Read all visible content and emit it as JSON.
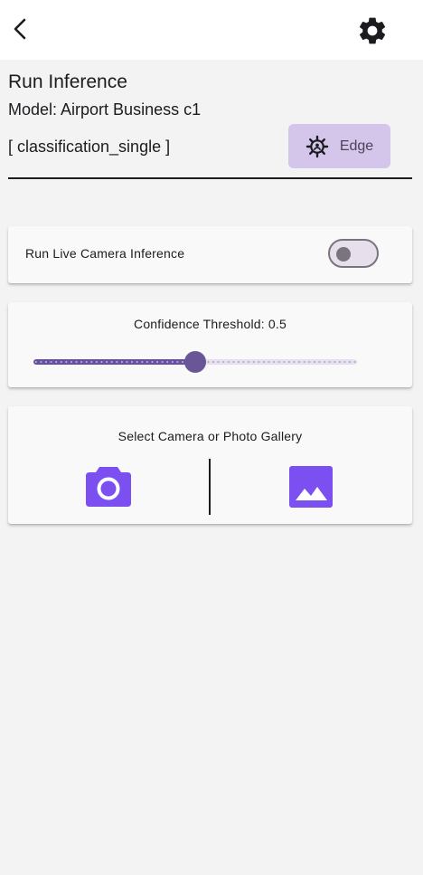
{
  "appbar": {
    "back_icon": "arrow-back-ios-icon",
    "settings_icon": "gear-icon"
  },
  "header": {
    "title": "Run Inference",
    "model": "Model: Airport Business c1",
    "task_type": "[ classification_single ]",
    "edge_chip": {
      "label": "Edge",
      "icon": "edge-device-icon"
    }
  },
  "live_inference": {
    "label": "Run Live Camera Inference",
    "enabled": false
  },
  "threshold": {
    "label": "Confidence Threshold: 0.5",
    "value": 0.5,
    "min": 0,
    "max": 1
  },
  "source": {
    "label": "Select Camera or Photo Gallery",
    "camera_icon": "camera-icon",
    "gallery_icon": "photo-gallery-icon"
  },
  "colors": {
    "accent": "#6750a4",
    "icon_purple": "#7b4ff0",
    "chip_background": "#d3c6ea",
    "background": "#f3f3f3",
    "card": "#f9f9f9"
  }
}
